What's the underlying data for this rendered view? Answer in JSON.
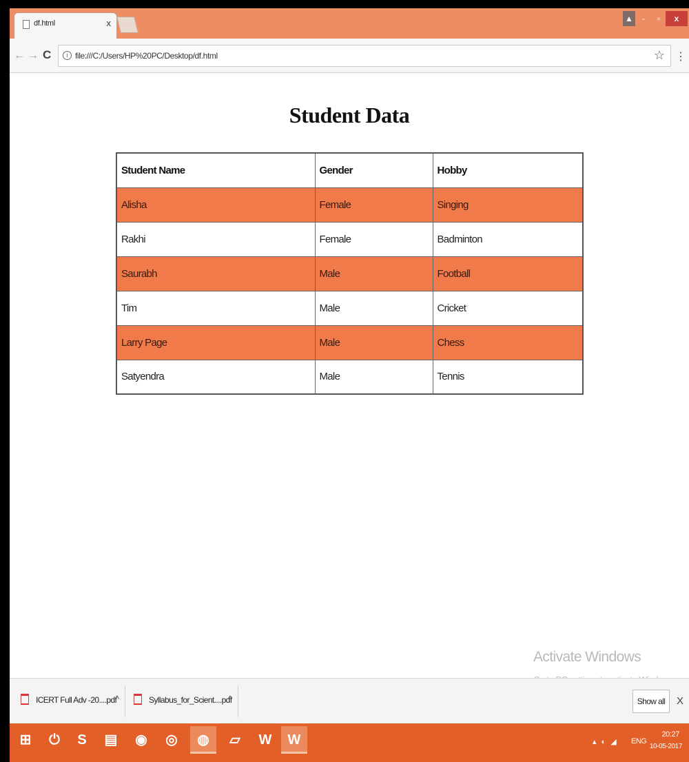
{
  "browser": {
    "tab": {
      "title": "df.html",
      "close": "x"
    },
    "window_controls": {
      "user": "▲",
      "minimize": "-",
      "maximize": "▫",
      "close": "x"
    },
    "address": {
      "url": "file:///C:/Users/HP%20PC/Desktop/df.html"
    }
  },
  "page": {
    "heading": "Student Data",
    "table": {
      "headers": [
        "Student Name",
        "Gender",
        "Hobby"
      ],
      "rows": [
        [
          "Alisha",
          "Female",
          "Singing"
        ],
        [
          "Rakhi",
          "Female",
          "Badminton"
        ],
        [
          "Saurabh",
          "Male",
          "Football"
        ],
        [
          "Tim",
          "Male",
          "Cricket"
        ],
        [
          "Larry Page",
          "Male",
          "Chess"
        ],
        [
          "Satyendra",
          "Male",
          "Tennis"
        ]
      ],
      "highlight_color": "#f07a4a"
    }
  },
  "watermark": {
    "title": "Activate Windows",
    "subtitle": "Go to PC settings to activate Windows."
  },
  "downloads": {
    "items": [
      {
        "name": "ICERT Full Adv -20....pdf",
        "caret": "^"
      },
      {
        "name": "Syllabus_for_Scient....pdf",
        "caret": "^"
      }
    ],
    "show_all": "Show all",
    "close": "X"
  },
  "taskbar": {
    "apps": [
      "start-icon",
      "power-icon",
      "skype-icon",
      "file-explorer-icon",
      "firefox-icon",
      "chrome-canary-icon",
      "chrome-icon",
      "notepad-icon",
      "word-icon",
      "word-icon"
    ],
    "tray": {
      "language": "ENG",
      "time": "20:27",
      "date": "10-05-2017"
    },
    "accent": "#e25f28"
  }
}
